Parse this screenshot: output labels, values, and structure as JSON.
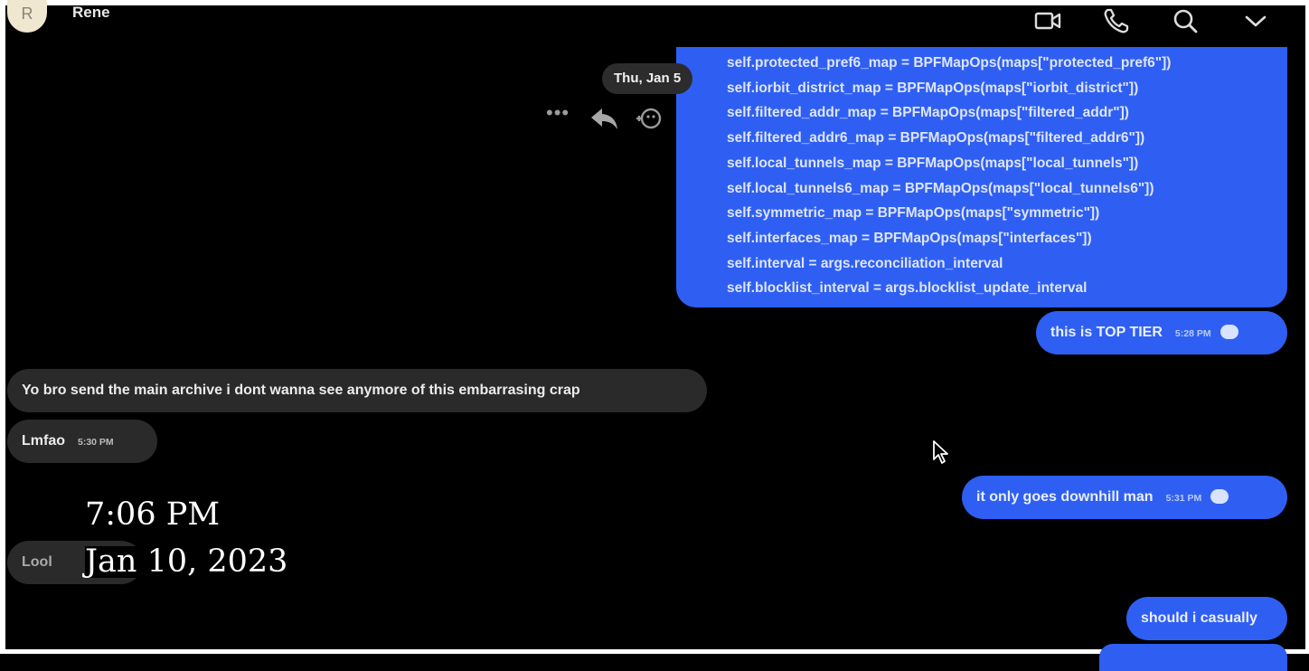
{
  "header": {
    "avatar_initial": "R",
    "contact_name": "Rene",
    "icons": [
      "video-call-icon",
      "phone-icon",
      "search-icon",
      "chevron-down-icon"
    ]
  },
  "thread": {
    "date_separator": "Thu, Jan 5",
    "code_message": [
      "self.protected_pref6_map = BPFMapOps(maps[\"protected_pref6\"])",
      "self.iorbit_district_map = BPFMapOps(maps[\"iorbit_district\"])",
      "self.filtered_addr_map = BPFMapOps(maps[\"filtered_addr\"])",
      "self.filtered_addr6_map = BPFMapOps(maps[\"filtered_addr6\"])",
      "self.local_tunnels_map = BPFMapOps(maps[\"local_tunnels\"])",
      "self.local_tunnels6_map = BPFMapOps(maps[\"local_tunnels6\"])",
      "self.symmetric_map = BPFMapOps(maps[\"symmetric\"])",
      "self.interfaces_map = BPFMapOps(maps[\"interfaces\"])",
      "self.interval = args.reconciliation_interval",
      "self.blocklist_interval = args.blocklist_update_interval"
    ],
    "messages": [
      {
        "text": "this is TOP TIER",
        "time": "5:28 PM"
      },
      {
        "text": "Yo bro send the main archive i dont wanna see anymore of this embarrasing crap"
      },
      {
        "text": "Lmfao",
        "time": "5:30 PM"
      },
      {
        "text": "it only goes downhill man",
        "time": "5:31 PM"
      },
      {
        "text": "Lool"
      },
      {
        "text": "should i casually"
      }
    ]
  },
  "overlay": {
    "time": "7:06 PM",
    "date": "Jan 10, 2023"
  },
  "colors": {
    "outgoing_bubble": "#2f5ff2",
    "incoming_bubble": "#2a2a2a",
    "background": "#000000"
  }
}
